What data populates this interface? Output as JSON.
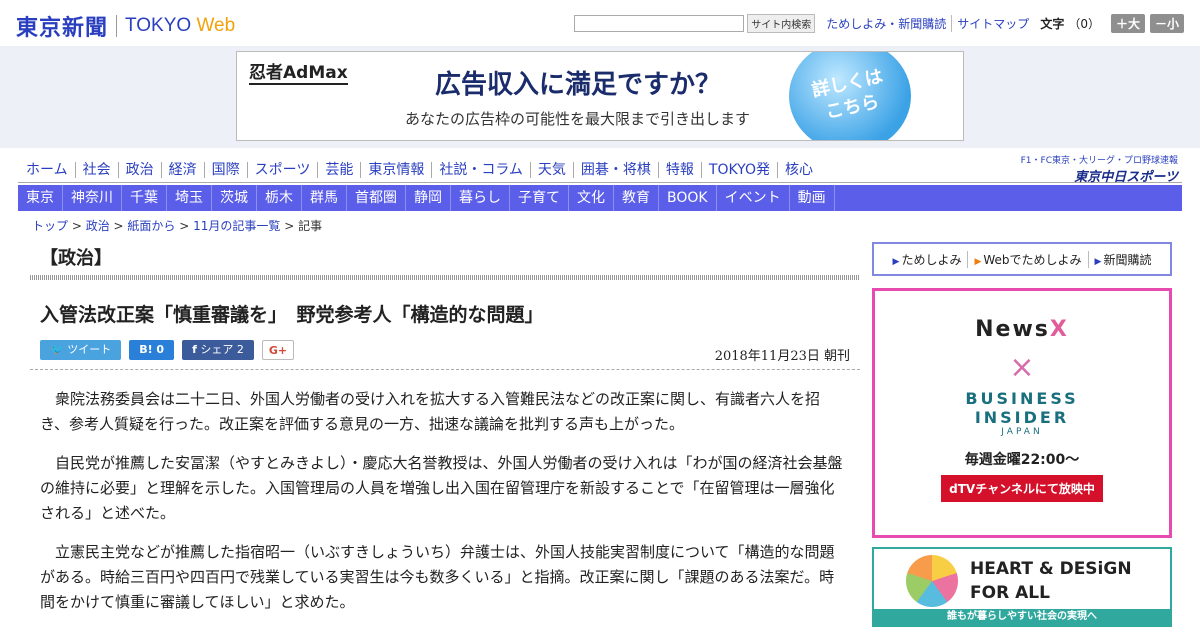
{
  "header": {
    "logo_kanji": "東京新聞",
    "logo_tokyo": "TOKYO",
    "logo_web": "Web",
    "search_button": "サイト内検索",
    "links": [
      "ためしよみ・新聞購読",
      "サイトマップ"
    ],
    "font_label": "文字",
    "font_count": "（0）",
    "font_plus": "＋大",
    "font_minus": "－小"
  },
  "ad_banner": {
    "brand": "忍者AdMax",
    "headline": "広告収入に満足ですか？",
    "subline": "あなたの広告枠の可能性を最大限まで引き出します",
    "cta": "詳しくは\nこちら"
  },
  "nav_primary": [
    "ホーム",
    "社会",
    "政治",
    "経済",
    "国際",
    "スポーツ",
    "芸能",
    "東京情報",
    "社説・コラム",
    "天気",
    "囲碁・将棋",
    "特報",
    "TOKYO発",
    "核心"
  ],
  "nav_secondary": [
    "東京",
    "神奈川",
    "千葉",
    "埼玉",
    "茨城",
    "栃木",
    "群馬",
    "首都圏",
    "静岡",
    "暮らし",
    "子育て",
    "文化",
    "教育",
    "BOOK",
    "イベント",
    "動画"
  ],
  "chunichi": {
    "top": "F1・FC東京・大リーグ・プロ野球速報",
    "logo": "東京中日スポーツ"
  },
  "breadcrumb": [
    "トップ",
    "政治",
    "紙面から",
    "11月の記事一覧",
    "記事"
  ],
  "section_title": "【政治】",
  "article": {
    "headline": "入管法改正案「慎重審議を」　野党参考人「構造的な問題」",
    "date": "2018年11月23日 朝刊",
    "paragraphs": [
      "衆院法務委員会は二十二日、外国人労働者の受け入れを拡大する入管難民法などの改正案に関し、有識者六人を招き、参考人質疑を行った。改正案を評価する意見の一方、拙速な議論を批判する声も上がった。",
      "自民党が推薦した安冨潔（やすとみきよし）・慶応大名誉教授は、外国人労働者の受け入れは「わが国の経済社会基盤の維持に必要」と理解を示した。入国管理局の人員を増強し出入国在留管理庁を新設することで「在留管理は一層強化される」と述べた。",
      "立憲民主党などが推薦した指宿昭一（いぶすきしょういち）弁護士は、外国人技能実習制度について「構造的な問題がある。時給三百円や四百円で残業している実習生は今も数多くいる」と指摘。改正案に関し「課題のある法案だ。時間をかけて慎重に審議してほしい」と求めた。"
    ]
  },
  "social": {
    "tweet": "ツイート",
    "hatena": "B! 0",
    "share": "シェア 2",
    "gplus": "G+"
  },
  "sidebar": {
    "links": [
      "ためしよみ",
      "Webでためしよみ",
      "新聞購読"
    ],
    "ad2": {
      "newsx_a": "News",
      "newsx_b": "X",
      "cross": "×",
      "bi1": "BUSINESS",
      "bi2": "INSIDER",
      "bi3": "JAPAN",
      "schedule": "毎週金曜22:00〜",
      "cta": "dTVチャンネルにて放映中"
    },
    "ad3": {
      "line1": "HEART & DESiGN",
      "line2": "FOR ALL",
      "strip": "誰もが暮らしやすい社会の実現へ"
    }
  }
}
